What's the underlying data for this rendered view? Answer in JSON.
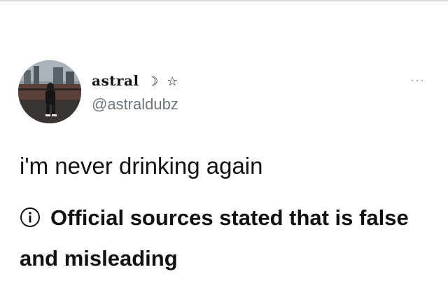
{
  "tweet": {
    "display_name": "astral",
    "name_moon": "☽",
    "name_star": "☆",
    "handle": "@astraldubz",
    "more_glyph": "···",
    "text": "i'm never drinking again",
    "notice": "Official sources stated that is false and misleading",
    "notice_icon": "info-circle-icon"
  },
  "colors": {
    "text": "#111111",
    "handle": "#6e767d",
    "border": "#d9d9d9"
  }
}
